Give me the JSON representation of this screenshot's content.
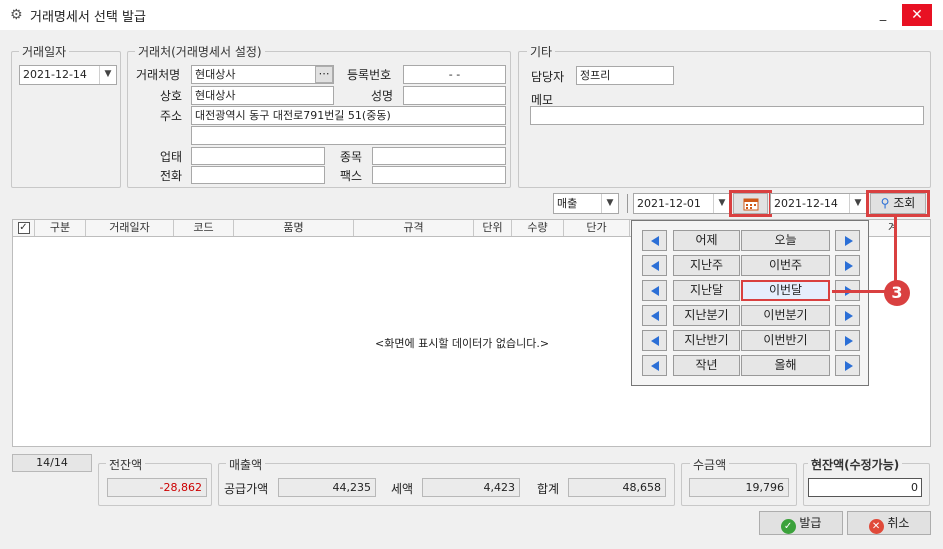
{
  "window": {
    "title": "거래명세서 선택 발급",
    "minimize": "_",
    "maximize": "□",
    "close": "✕"
  },
  "date_group": {
    "legend": "거래일자",
    "date": "2021-12-14"
  },
  "customer_group": {
    "legend": "거래처(거래명세서 설정)",
    "name_label": "거래처명",
    "name_value": "현대상사",
    "reg_label": "등록번호",
    "reg_value": "-  -",
    "company_label": "상호",
    "company_value": "현대상사",
    "ceo_label": "성명",
    "ceo_value": "",
    "addr_label": "주소",
    "addr_value": "대전광역시 동구 대전로791번길 51(중동)",
    "addr2_value": "",
    "biztype_label": "업태",
    "biztype_value": "",
    "item_label": "종목",
    "item_value": "",
    "phone_label": "전화",
    "phone_value": "",
    "fax_label": "팩스",
    "fax_value": ""
  },
  "etc_group": {
    "legend": "기타",
    "manager_label": "담당자",
    "manager_value": "정프리",
    "memo_label": "메모",
    "memo_value": ""
  },
  "filter": {
    "type": "매출",
    "from": "2021-12-01",
    "to": "2021-12-14",
    "search_label": "조회"
  },
  "grid": {
    "columns": [
      "구분",
      "거래일자",
      "코드",
      "품명",
      "규격",
      "단위",
      "수량",
      "단가",
      "계"
    ],
    "empty_message": "<화면에 표시할 데이터가 없습니다.>"
  },
  "popup": {
    "rows": [
      [
        "어제",
        "오늘"
      ],
      [
        "지난주",
        "이번주"
      ],
      [
        "지난달",
        "이번달"
      ],
      [
        "지난분기",
        "이번분기"
      ],
      [
        "지난반기",
        "이번반기"
      ],
      [
        "작년",
        "올해"
      ]
    ],
    "highlighted": "이번달"
  },
  "callout": "3",
  "footer": {
    "count": "14/14",
    "prev_balance_legend": "전잔액",
    "prev_balance": "-28,862",
    "sales_legend": "매출액",
    "supply_label": "공급가액",
    "supply_value": "44,235",
    "tax_label": "세액",
    "tax_value": "4,423",
    "total_label": "합계",
    "total_value": "48,658",
    "received_legend": "수금액",
    "received_value": "19,796",
    "current_legend": "현잔액(수정가능)",
    "current_value": "0"
  },
  "actions": {
    "issue": "발급",
    "cancel": "취소"
  },
  "colors": {
    "highlight": "#d94040",
    "accent_blue": "#2b6fd6",
    "negative": "#cc0000"
  }
}
